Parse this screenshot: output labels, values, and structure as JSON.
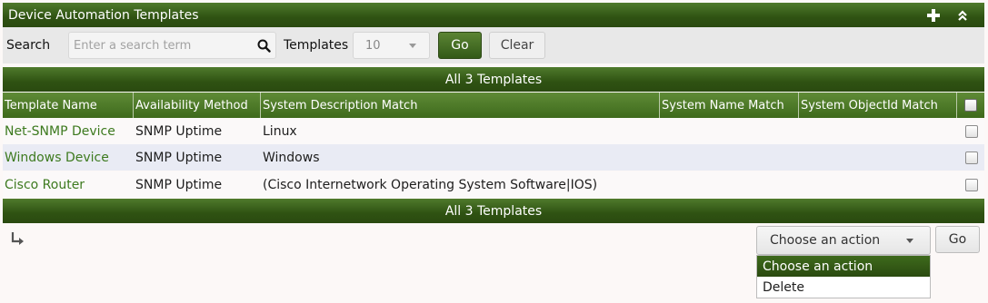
{
  "panel": {
    "title": "Device Automation Templates",
    "add_icon": "plus-icon",
    "collapse_icon": "double-chevron-up-icon"
  },
  "search": {
    "label": "Search",
    "placeholder": "Enter a search term",
    "value": "",
    "icon": "magnifier-icon"
  },
  "page_size": {
    "label": "Templates",
    "value": "10"
  },
  "buttons": {
    "go": "Go",
    "clear": "Clear"
  },
  "count_text": "All 3 Templates",
  "table": {
    "columns": [
      "Template Name",
      "Availability Method",
      "System Description Match",
      "System Name Match",
      "System ObjectId Match"
    ],
    "rows": [
      {
        "name": "Net-SNMP Device",
        "availability": "SNMP Uptime",
        "sys_descr": "Linux",
        "sys_name": "",
        "sys_objectid": ""
      },
      {
        "name": "Windows Device",
        "availability": "SNMP Uptime",
        "sys_descr": "Windows",
        "sys_name": "",
        "sys_objectid": ""
      },
      {
        "name": "Cisco Router",
        "availability": "SNMP Uptime",
        "sys_descr": "(Cisco Internetwork Operating System Software|IOS)",
        "sys_name": "",
        "sys_objectid": ""
      }
    ]
  },
  "actions": {
    "selected": "Choose an action",
    "options": [
      "Choose an action",
      "Delete"
    ],
    "go": "Go"
  },
  "colors": {
    "header_green": "#2f5212",
    "row_alt": "#e9ebf4",
    "link_green": "#3d7a1f"
  }
}
